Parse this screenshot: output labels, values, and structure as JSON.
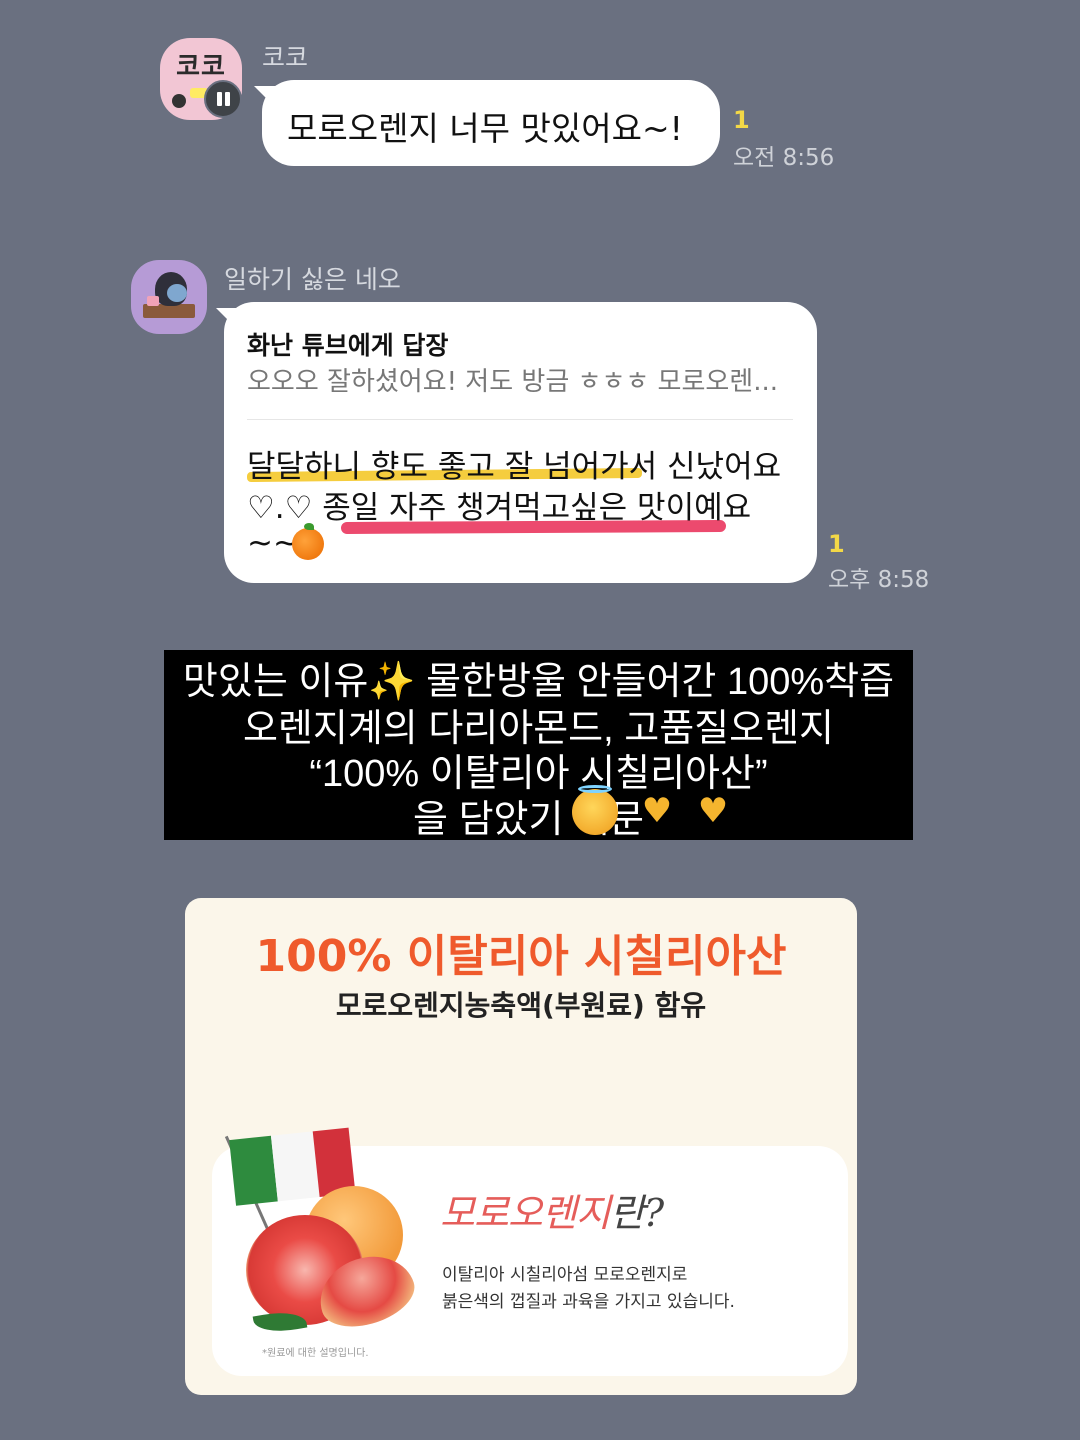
{
  "chat1": {
    "avatar_text": "코코",
    "sender": "코코",
    "message": "모로오렌지 너무 맛있어요~!",
    "unread": "1",
    "time": "오전 8:56"
  },
  "chat2": {
    "sender": "일하기 싫은 네오",
    "reply_title": "화난 튜브에게 답장",
    "reply_quote": "오오오 잘하셨어요! 저도 방금 ㅎㅎㅎ 모로오렌...",
    "message_lines": [
      "달달하니 향도 좋고 잘 넘어가서 신났어요",
      "♡.♡  종일 자주 챙겨먹고싶은 맛이예요",
      "~~"
    ],
    "unread": "1",
    "time": "오후 8:58",
    "highlight_colors": {
      "yellow": "#f5cd3e",
      "pink": "#ec4a6e"
    }
  },
  "caption": {
    "lines": [
      "맛있는 이유✨ 물한방울 안들어간 100%착즙",
      "오렌지계의 다리아몬드, 고품질오렌지",
      "“100% 이탈리아 시칠리아산”",
      "을 담았기 때문"
    ],
    "emojis": [
      "smiling-face-with-halo",
      "heart-hands",
      "heart-hands"
    ]
  },
  "product": {
    "title": "100% 이탈리아 시칠리아산",
    "subtitle": "모로오렌지농축액(부원료) 함유",
    "heading_red": "모로오렌지",
    "heading_rest": "란?",
    "desc_lines": [
      "이탈리아 시칠리아섬 모로오렌지로",
      "붉은색의 껍질과 과육을 가지고 있습니다."
    ],
    "footnote": "*원료에 대한 설명입니다.",
    "accent_color": "#ef5a2c"
  }
}
